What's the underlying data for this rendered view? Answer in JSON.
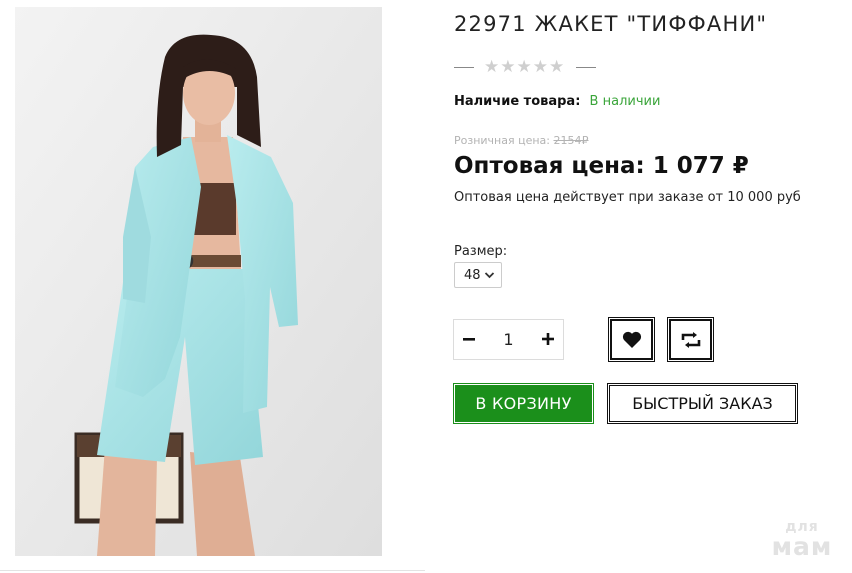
{
  "product": {
    "title": "22971 ЖАКЕТ \"ТИФФАНИ\"",
    "rating": {
      "stars_filled": 0,
      "stars_total": 5
    },
    "availability_label": "Наличие товара:",
    "availability_value": "В наличии",
    "retail_label": "Розничная цена:",
    "retail_price": "2154₽",
    "wholesale_label": "Оптовая цена:",
    "wholesale_price": "1 077 ₽",
    "wholesale_note": "Оптовая цена действует при заказе от 10 000 руб",
    "size_label": "Размер:",
    "size_selected": "48",
    "quantity": "1"
  },
  "actions": {
    "minus": "−",
    "plus": "+",
    "add_to_cart": "В КОРЗИНУ",
    "quick_order": "БЫСТРЫЙ ЗАКАЗ",
    "favorite_icon": "heart-icon",
    "compare_icon": "compare-icon"
  },
  "watermark": {
    "line1": "для",
    "line2": "мам"
  },
  "colors": {
    "accent_green": "#1b8f1b",
    "in_stock_green": "#3aa53a",
    "jacket_mint": "#a8e3e6"
  }
}
